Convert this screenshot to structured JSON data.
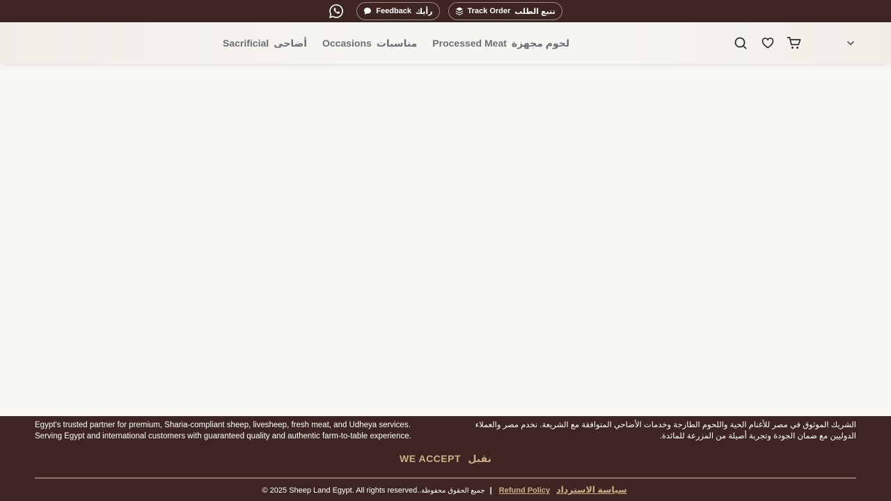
{
  "topbar": {
    "whatsapp_icon": "whatsapp-icon",
    "feedback": {
      "label_en": "Feedback",
      "label_ar": "رأيك",
      "icon": "chat-bubble-icon"
    },
    "track_order": {
      "label_en": "Track Order",
      "label_ar": "تتبع الطلب",
      "icon": "stack-icon"
    }
  },
  "nav": {
    "items": [
      {
        "en": "Sacrificial",
        "ar": "أضاحى"
      },
      {
        "en": "Occasions",
        "ar": "مناسبات"
      },
      {
        "en": "Processed Meat",
        "ar": "لحوم مجهزة"
      }
    ]
  },
  "header_icons": [
    "search-icon",
    "heart-icon",
    "cart-icon",
    "chevron-down-icon"
  ],
  "footer": {
    "en_line1": "Egypt's trusted partner for premium, Sharia-compliant sheep, livesheep, fresh meat, and Udheya services.",
    "en_line2": "Serving Egypt and international customers with guaranteed quality and authentic farm-to-table experience.",
    "ar_line1": "الشريك الموثوق في مصر للأغنام الحية واللحوم الطازجة وخدمات الأضاحي المتوافقة مع الشريعة. نخدم مصر والعملاء",
    "ar_line2": "الدوليين مع ضمان الجودة وتجربة أصيلة من المزرعة للمائدة.",
    "we_accept_en": "WE ACCEPT",
    "we_accept_ar": "نقبل",
    "copyright": "© 2025 Sheep Land Egypt. All rights reserved.",
    "copyright_ar": ".جميع الحقوق محفوظة",
    "separator": "|",
    "refund_en": "Refund Policy",
    "refund_ar": "سياسة الاسترداد"
  },
  "colors": {
    "brand_dark": "#3d2622",
    "accent_gold": "#cdb08a",
    "nav_text": "#6b6f75",
    "page_bg": "#f8f7f3"
  }
}
